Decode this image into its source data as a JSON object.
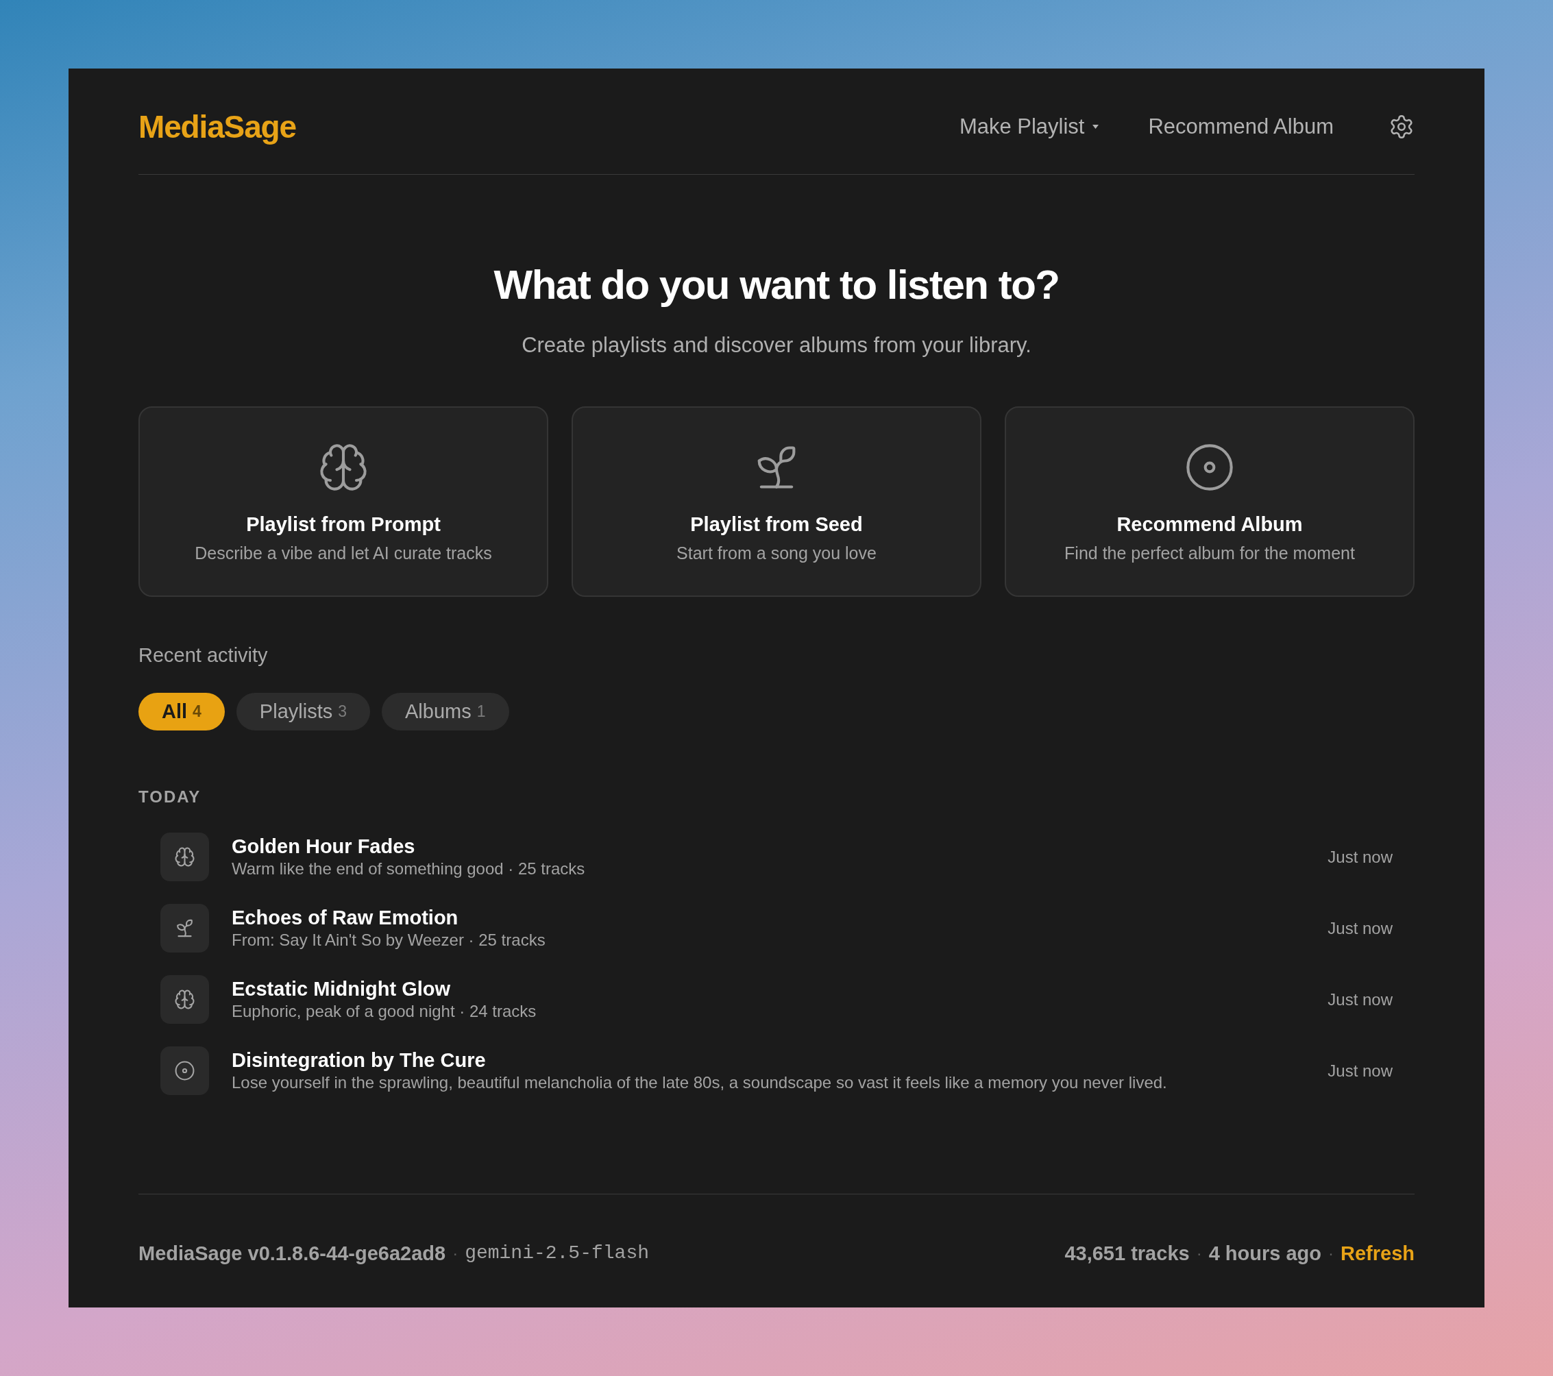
{
  "header": {
    "logo": "MediaSage",
    "nav": [
      {
        "label": "Make Playlist",
        "kind": "dropdown"
      },
      {
        "label": "Recommend Album",
        "kind": "link"
      }
    ]
  },
  "hero": {
    "title": "What do you want to listen to?",
    "subtitle": "Create playlists and discover albums from your library."
  },
  "cards": [
    {
      "kind": "prompt",
      "title": "Playlist from Prompt",
      "description": "Describe a vibe and let AI curate tracks"
    },
    {
      "kind": "seed",
      "title": "Playlist from Seed",
      "description": "Start from a song you love"
    },
    {
      "kind": "album",
      "title": "Recommend Album",
      "description": "Find the perfect album for the moment"
    }
  ],
  "recent": {
    "heading": "Recent activity",
    "filters": [
      {
        "label": "All",
        "count": "4",
        "selected": true
      },
      {
        "label": "Playlists",
        "count": "3",
        "selected": false
      },
      {
        "label": "Albums",
        "count": "1",
        "selected": false
      }
    ],
    "groups": [
      {
        "label": "TODAY",
        "items": [
          {
            "kind": "prompt",
            "title": "Golden Hour Fades",
            "subtitle": "Warm like the end of something good · 25 tracks",
            "time": "Just now"
          },
          {
            "kind": "seed",
            "title": "Echoes of Raw Emotion",
            "subtitle": "From: Say It Ain't So by Weezer · 25 tracks",
            "time": "Just now"
          },
          {
            "kind": "prompt",
            "title": "Ecstatic Midnight Glow",
            "subtitle": "Euphoric, peak of a good night · 24 tracks",
            "time": "Just now"
          },
          {
            "kind": "album",
            "title": "Disintegration by The Cure",
            "subtitle": "Lose yourself in the sprawling, beautiful melancholia of the late 80s, a soundscape so vast it feels like a memory you never lived.",
            "time": "Just now"
          }
        ]
      }
    ]
  },
  "footer": {
    "left": [
      {
        "kind": "text",
        "text": "MediaSage v0.1.8.6-44-ge6a2ad8"
      },
      {
        "kind": "separator",
        "text": "·"
      },
      {
        "kind": "code",
        "text": "gemini-2.5-flash"
      }
    ],
    "right": [
      {
        "kind": "text",
        "text": "43,651 tracks"
      },
      {
        "kind": "separator",
        "text": "·"
      },
      {
        "kind": "text",
        "text": "4 hours ago"
      },
      {
        "kind": "separator",
        "text": "·"
      },
      {
        "kind": "link",
        "text": "Refresh"
      }
    ]
  }
}
